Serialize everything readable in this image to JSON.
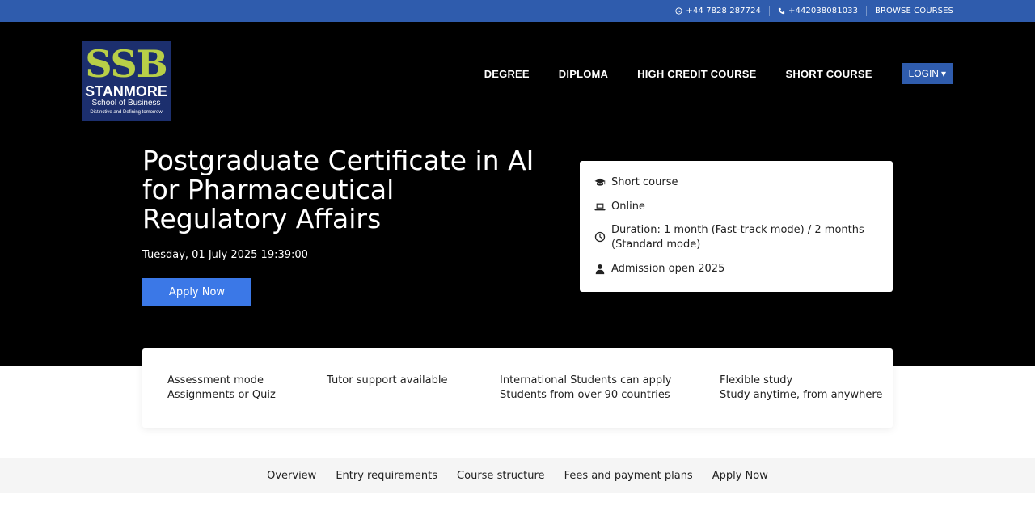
{
  "topbar": {
    "whatsapp": "+44 7828 287724",
    "phone": "+442038081033",
    "browse": "BROWSE COURSES"
  },
  "logo": {
    "letters": "SSB",
    "name": "STANMORE",
    "subtitle": "School of Business",
    "tagline": "Distinctive and Defining tomorrow"
  },
  "nav": {
    "items": [
      "DEGREE",
      "DIPLOMA",
      "HIGH CREDIT COURSE",
      "SHORT COURSE"
    ],
    "login": "LOGIN",
    "login_caret": "▾"
  },
  "hero": {
    "title": "Postgraduate Certificate in AI for Pharmaceutical Regulatory Affairs",
    "datetime": "Tuesday, 01 July 2025 19:39:00",
    "apply": "Apply Now"
  },
  "info": {
    "type": "Short course",
    "mode": "Online",
    "duration": "Duration: 1 month (Fast-track mode) / 2 months (Standard mode)",
    "admission": "Admission open 2025"
  },
  "features": [
    {
      "line1": "Assessment mode",
      "line2": "Assignments or Quiz"
    },
    {
      "line1": "Tutor support available",
      "line2": ""
    },
    {
      "line1": "International Students can apply",
      "line2": "Students from over 90 countries"
    },
    {
      "line1": "Flexible study",
      "line2": "Study anytime, from anywhere"
    }
  ],
  "tabs": [
    "Overview",
    "Entry requirements",
    "Course structure",
    "Fees and payment plans",
    "Apply Now"
  ],
  "colors": {
    "topbar": "#2f5cad",
    "hero_bg": "#000000",
    "apply_btn": "#3b78e7",
    "logo_bg": "#1c2f6e",
    "logo_letters": "#b8cf47"
  }
}
